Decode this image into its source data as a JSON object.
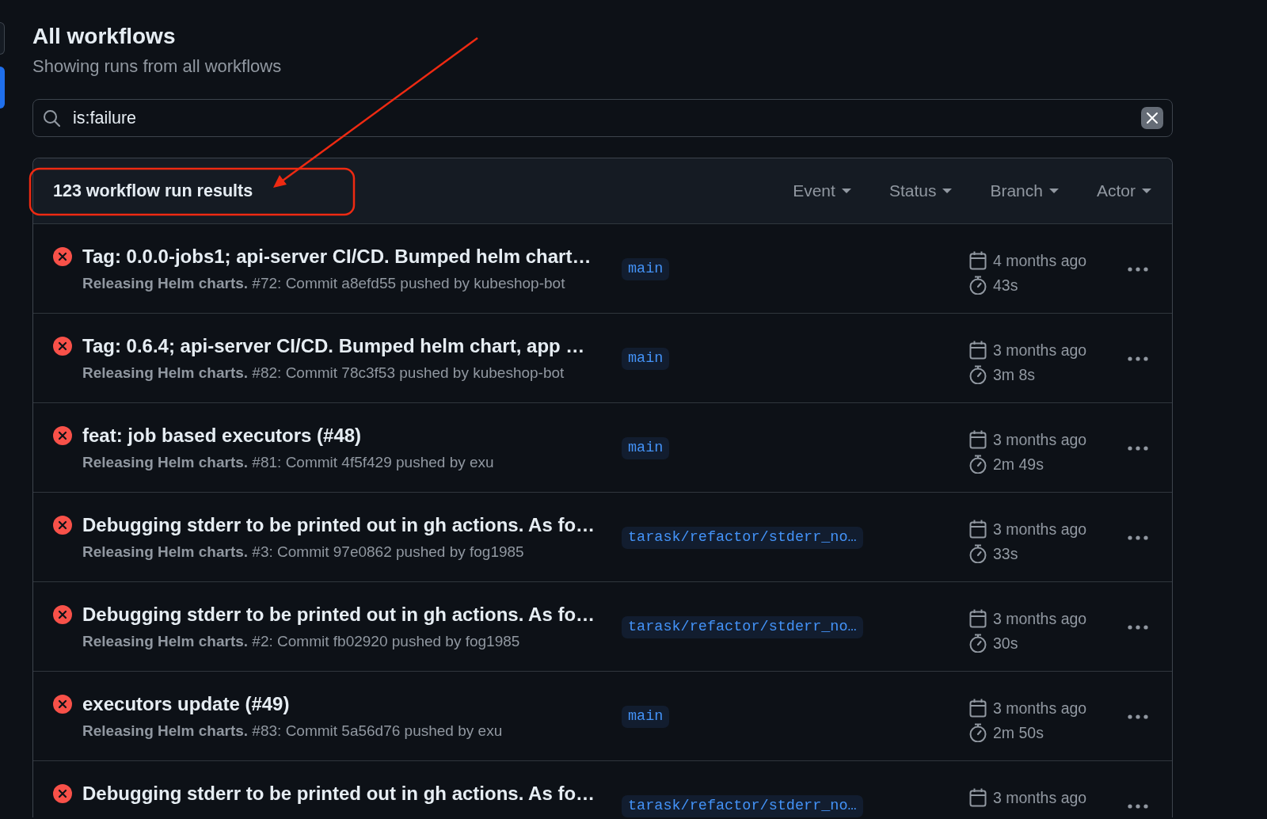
{
  "page": {
    "title": "All workflows",
    "subtitle": "Showing runs from all workflows"
  },
  "sidebar_edge": {
    "items": [
      {
        "selected": false
      },
      {
        "selected": true
      }
    ]
  },
  "search": {
    "value": "is:failure"
  },
  "results": {
    "count_label": "123 workflow run results",
    "filters": [
      "Event",
      "Status",
      "Branch",
      "Actor"
    ]
  },
  "runs": [
    {
      "failed": true,
      "title": "Tag: 0.0.0-jobs1; api-server CI/CD. Bumped helm chart…",
      "details": "**Releasing Helm charts.** #72: Commit a8efd55 pushed by kubeshop-bot",
      "branch": "main",
      "date": "4 months ago",
      "duration": "43s"
    },
    {
      "failed": true,
      "title": "Tag: 0.6.4; api-server CI/CD. Bumped helm chart, app …",
      "details": "**Releasing Helm charts.** #82: Commit 78c3f53 pushed by kubeshop-bot",
      "branch": "main",
      "date": "3 months ago",
      "duration": "3m 8s"
    },
    {
      "failed": true,
      "title": "feat: job based executors (#48)",
      "details": "**Releasing Helm charts.** #81: Commit 4f5f429 pushed by exu",
      "branch": "main",
      "date": "3 months ago",
      "duration": "2m 49s"
    },
    {
      "failed": true,
      "title": "Debugging stderr to be printed out in gh actions. As fo…",
      "details": "**Releasing Helm charts.** #3: Commit 97e0862 pushed by fog1985",
      "branch": "tarask/refactor/stderr_no…",
      "date": "3 months ago",
      "duration": "33s"
    },
    {
      "failed": true,
      "title": "Debugging stderr to be printed out in gh actions. As fo…",
      "details": "**Releasing Helm charts.** #2: Commit fb02920 pushed by fog1985",
      "branch": "tarask/refactor/stderr_no…",
      "date": "3 months ago",
      "duration": "30s"
    },
    {
      "failed": true,
      "title": "executors update (#49)",
      "details": "**Releasing Helm charts.** #83: Commit 5a56d76 pushed by exu",
      "branch": "main",
      "date": "3 months ago",
      "duration": "2m 50s"
    },
    {
      "failed": true,
      "title": "Debugging stderr to be printed out in gh actions. As fo…",
      "branch": "tarask/refactor/stderr_no…",
      "date": "3 months ago"
    }
  ],
  "annotation": {
    "highlight_frame": true,
    "arrow": true
  }
}
